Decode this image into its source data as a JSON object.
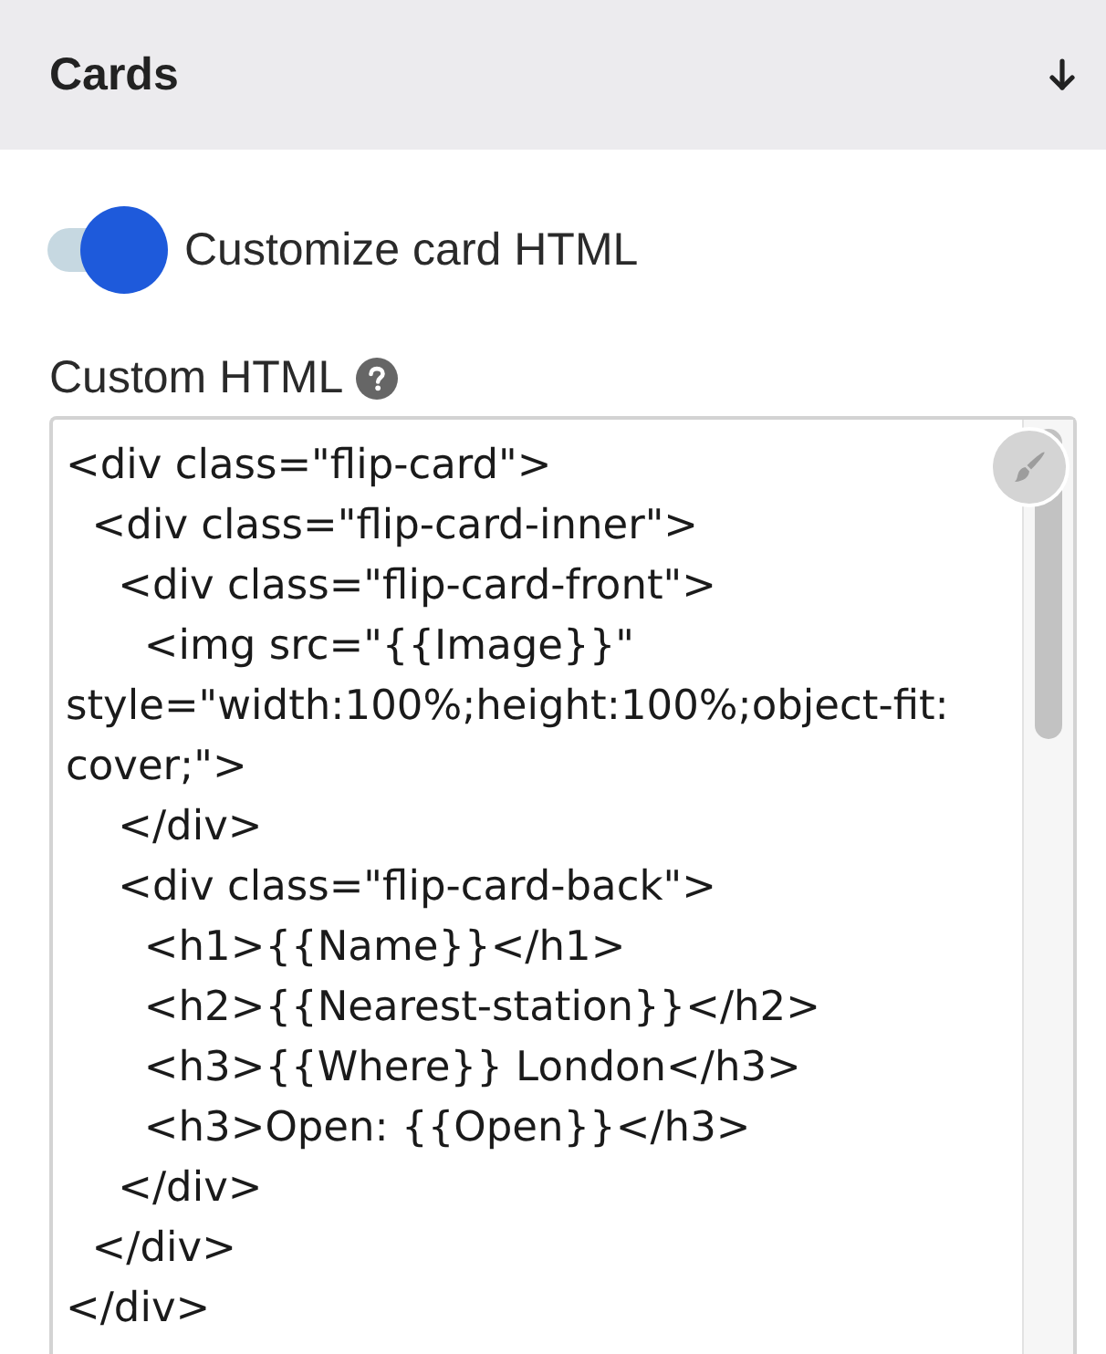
{
  "panel": {
    "title": "Cards"
  },
  "toggle": {
    "label": "Customize card HTML",
    "on": true
  },
  "custom_html": {
    "label": "Custom HTML",
    "value": "<div class=\"flip-card\">\n  <div class=\"flip-card-inner\">\n    <div class=\"flip-card-front\">\n      <img src=\"{{Image}}\"\nstyle=\"width:100%;height:100%;object-fit:\ncover;\">\n    </div>\n    <div class=\"flip-card-back\">\n      <h1>{{Name}}</h1>\n      <h2>{{Nearest-station}}</h2>\n      <h3>{{Where}} London</h3>\n      <h3>Open: {{Open}}</h3>\n    </div>\n  </div>\n</div>"
  }
}
